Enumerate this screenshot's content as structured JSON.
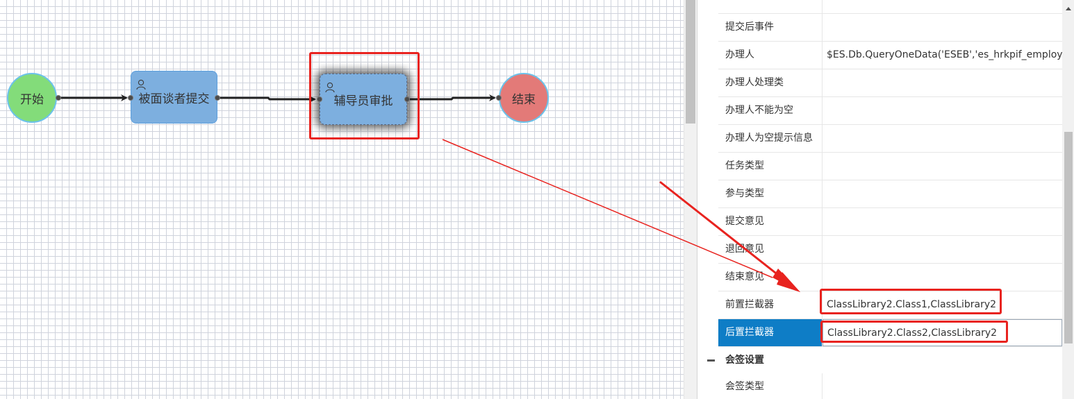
{
  "canvas": {
    "start_label": "开始",
    "task1_label": "被面谈者提交",
    "task2_label": "辅导员审批",
    "end_label": "结束"
  },
  "properties": {
    "rows": [
      {
        "name": "提交后事件",
        "value": ""
      },
      {
        "name": "办理人",
        "value": "$ES.Db.QueryOneData('ESEB','es_hrkpif_employe"
      },
      {
        "name": "办理人处理类",
        "value": ""
      },
      {
        "name": "办理人不能为空",
        "value": ""
      },
      {
        "name": "办理人为空提示信息",
        "value": ""
      },
      {
        "name": "任务类型",
        "value": ""
      },
      {
        "name": "参与类型",
        "value": ""
      },
      {
        "name": "提交意见",
        "value": ""
      },
      {
        "name": "退回意见",
        "value": ""
      },
      {
        "name": "结束意见",
        "value": ""
      },
      {
        "name": "前置拦截器",
        "value": "ClassLibrary2.Class1,ClassLibrary2"
      },
      {
        "name": "后置拦截器",
        "value": "ClassLibrary2.Class2,ClassLibrary2"
      }
    ],
    "group": {
      "label": "会签设置"
    },
    "last_row": {
      "name": "会签类型",
      "value": ""
    }
  },
  "colors": {
    "start": "#83dc7a",
    "task": "#7dafdf",
    "end": "#e37a78",
    "highlight": "#e8231f",
    "selected_row": "#0e7dc6"
  }
}
